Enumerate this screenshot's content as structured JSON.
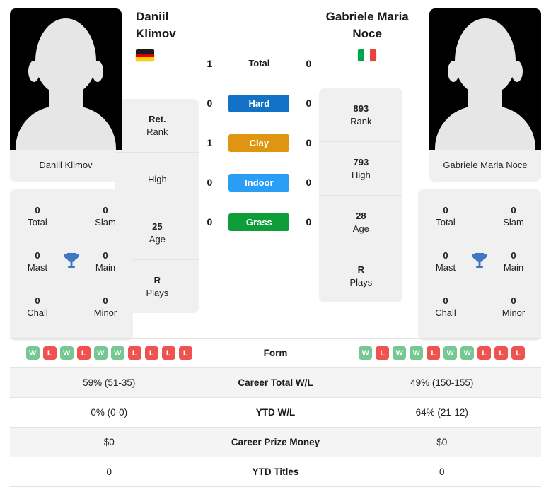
{
  "players": {
    "left": {
      "name": "Daniil Klimov",
      "photo_caption": "Daniil Klimov",
      "country": "Germany",
      "flag_colors": [
        "#1a1a1a",
        "#dd0000",
        "#ffce00"
      ],
      "titles": [
        {
          "value": "0",
          "label": "Total"
        },
        {
          "value": "0",
          "label": "Slam"
        },
        {
          "value": "0",
          "label": "Mast"
        },
        {
          "value": "0",
          "label": "Main"
        },
        {
          "value": "0",
          "label": "Chall"
        },
        {
          "value": "0",
          "label": "Minor"
        }
      ],
      "info": [
        {
          "value": "Ret.",
          "label": "Rank"
        },
        {
          "value": "",
          "label": "High"
        },
        {
          "value": "25",
          "label": "Age"
        },
        {
          "value": "R",
          "label": "Plays"
        }
      ],
      "form": [
        "W",
        "L",
        "W",
        "L",
        "W",
        "W",
        "L",
        "L",
        "L",
        "L"
      ],
      "career_total_wl": "59% (51-35)",
      "ytd_wl": "0% (0-0)",
      "career_prize_money": "$0",
      "ytd_titles": "0"
    },
    "right": {
      "name": "Gabriele Maria Noce",
      "photo_caption": "Gabriele Maria Noce",
      "country": "Italy",
      "flag_colors": [
        "#00a550",
        "#ffffff",
        "#e8433f"
      ],
      "titles": [
        {
          "value": "0",
          "label": "Total"
        },
        {
          "value": "0",
          "label": "Slam"
        },
        {
          "value": "0",
          "label": "Mast"
        },
        {
          "value": "0",
          "label": "Main"
        },
        {
          "value": "0",
          "label": "Chall"
        },
        {
          "value": "0",
          "label": "Minor"
        }
      ],
      "info": [
        {
          "value": "893",
          "label": "Rank"
        },
        {
          "value": "793",
          "label": "High"
        },
        {
          "value": "28",
          "label": "Age"
        },
        {
          "value": "R",
          "label": "Plays"
        }
      ],
      "form": [
        "W",
        "L",
        "W",
        "W",
        "L",
        "W",
        "W",
        "L",
        "L",
        "L"
      ],
      "career_total_wl": "49% (150-155)",
      "ytd_wl": "64% (21-12)",
      "career_prize_money": "$0",
      "ytd_titles": "0"
    }
  },
  "h2h": [
    {
      "label": "Total",
      "left": "1",
      "right": "0",
      "badge": false,
      "color": ""
    },
    {
      "label": "Hard",
      "left": "0",
      "right": "0",
      "badge": true,
      "color": "#1273c6"
    },
    {
      "label": "Clay",
      "left": "1",
      "right": "0",
      "badge": true,
      "color": "#e09510"
    },
    {
      "label": "Indoor",
      "left": "0",
      "right": "0",
      "badge": true,
      "color": "#2a9df4"
    },
    {
      "label": "Grass",
      "left": "0",
      "right": "0",
      "badge": true,
      "color": "#0f9d3a"
    }
  ],
  "table": {
    "rows": [
      {
        "label": "Form",
        "type": "form"
      },
      {
        "label": "Career Total W/L",
        "type": "text",
        "key": "career_total_wl"
      },
      {
        "label": "YTD W/L",
        "type": "text",
        "key": "ytd_wl"
      },
      {
        "label": "Career Prize Money",
        "type": "text",
        "key": "career_prize_money"
      },
      {
        "label": "YTD Titles",
        "type": "text",
        "key": "ytd_titles"
      }
    ]
  },
  "colors": {
    "win": "#76c893",
    "loss": "#ef5350",
    "card_bg": "#f0f0f0",
    "row_alt": "#f4f4f4",
    "trophy": "#3f77c4"
  },
  "icons": {
    "trophy": "trophy-icon"
  }
}
